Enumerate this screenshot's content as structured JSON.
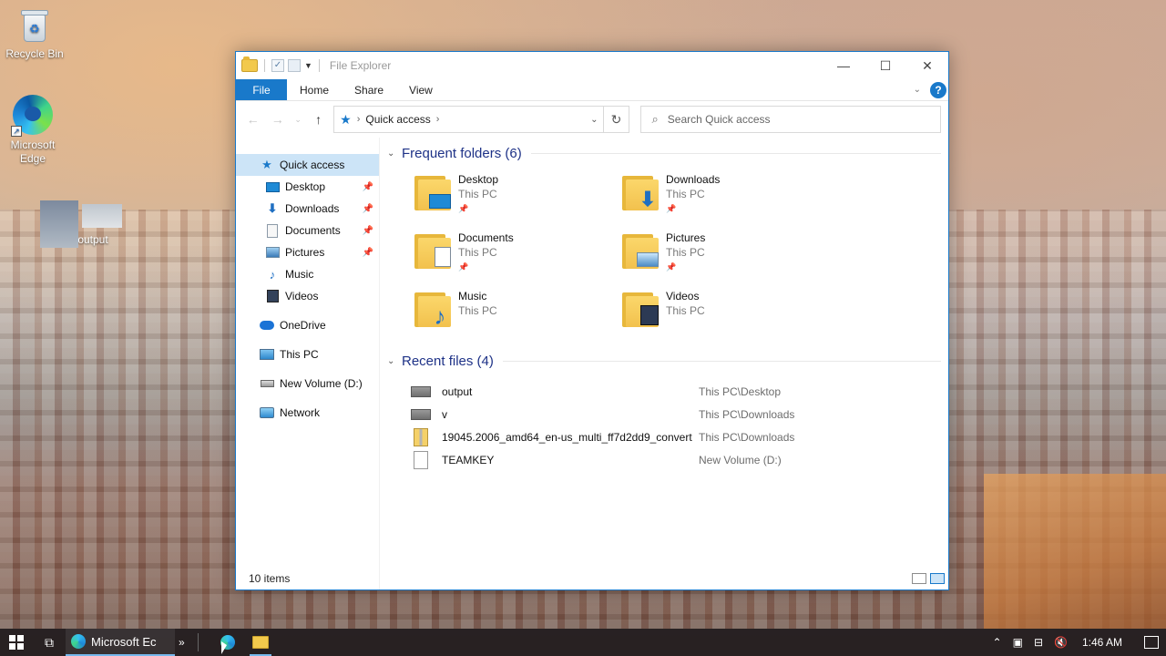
{
  "desktop": {
    "icons": [
      {
        "label": "Recycle Bin",
        "icon": "recycle-bin-icon"
      },
      {
        "label": "Microsoft Edge",
        "icon": "edge-icon"
      },
      {
        "label": "output",
        "icon": "image-file-icon"
      }
    ]
  },
  "window": {
    "title": "File Explorer",
    "controls": {
      "minimize": "—",
      "maximize": "☐",
      "close": "✕"
    }
  },
  "ribbon": {
    "tabs": [
      "File",
      "Home",
      "Share",
      "View"
    ],
    "help": "?"
  },
  "address": {
    "crumb": "Quick access",
    "search_placeholder": "Search Quick access"
  },
  "sidebar": {
    "items": [
      {
        "label": "Quick access",
        "icon": "star-icon",
        "active": true
      },
      {
        "label": "Desktop",
        "icon": "desktop-icon",
        "pinned": true
      },
      {
        "label": "Downloads",
        "icon": "download-icon",
        "pinned": true
      },
      {
        "label": "Documents",
        "icon": "documents-icon",
        "pinned": true
      },
      {
        "label": "Pictures",
        "icon": "pictures-icon",
        "pinned": true
      },
      {
        "label": "Music",
        "icon": "music-icon"
      },
      {
        "label": "Videos",
        "icon": "videos-icon"
      },
      {
        "label": "OneDrive",
        "icon": "cloud-icon"
      },
      {
        "label": "This PC",
        "icon": "computer-icon"
      },
      {
        "label": "New Volume (D:)",
        "icon": "drive-icon"
      },
      {
        "label": "Network",
        "icon": "network-icon"
      }
    ]
  },
  "frequent": {
    "heading": "Frequent folders (6)",
    "folders": [
      {
        "name": "Desktop",
        "location": "This PC",
        "pinned": true
      },
      {
        "name": "Downloads",
        "location": "This PC",
        "pinned": true
      },
      {
        "name": "Documents",
        "location": "This PC",
        "pinned": true
      },
      {
        "name": "Pictures",
        "location": "This PC",
        "pinned": true
      },
      {
        "name": "Music",
        "location": "This PC",
        "pinned": false
      },
      {
        "name": "Videos",
        "location": "This PC",
        "pinned": false
      }
    ]
  },
  "recent": {
    "heading": "Recent files (4)",
    "files": [
      {
        "name": "output",
        "path": "This PC\\Desktop"
      },
      {
        "name": "v",
        "path": "This PC\\Downloads"
      },
      {
        "name": "19045.2006_amd64_en-us_multi_ff7d2dd9_convert",
        "path": "This PC\\Downloads"
      },
      {
        "name": "TEAMKEY",
        "path": "New Volume (D:)"
      }
    ]
  },
  "status": {
    "items": "10 items"
  },
  "taskbar": {
    "edge_label": "Microsoft Ec",
    "clock": "1:46 AM"
  },
  "colors": {
    "accent": "#1979ca",
    "heading": "#1e3287"
  }
}
